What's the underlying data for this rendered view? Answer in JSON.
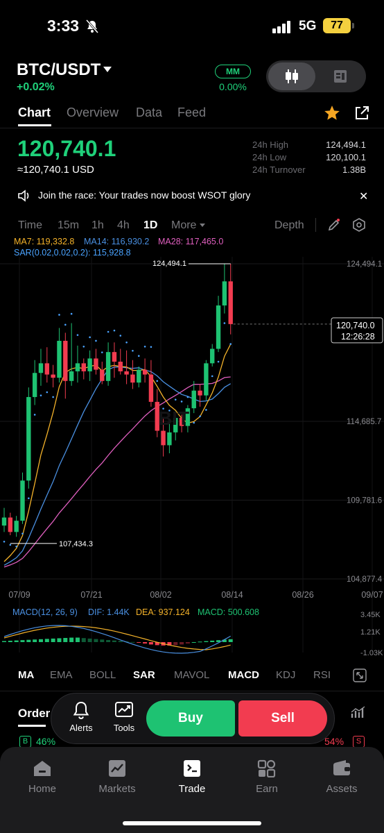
{
  "status": {
    "time": "3:33",
    "network": "5G",
    "battery": "77"
  },
  "header": {
    "pair": "BTC/USDT",
    "change": "+0.02%",
    "mm_label": "MM",
    "mm_value": "0.00%"
  },
  "tabs": [
    "Chart",
    "Overview",
    "Data",
    "Feed"
  ],
  "price": {
    "last": "120,740.1",
    "usd": "≈120,740.1 USD",
    "stats": [
      {
        "label": "24h High",
        "value": "124,494.1"
      },
      {
        "label": "24h Low",
        "value": "120,100.1"
      },
      {
        "label": "24h Turnover",
        "value": "1.38B"
      }
    ]
  },
  "announcement": "Join the race: Your trades now boost WSOT glory",
  "timeframes": [
    "Time",
    "15m",
    "1h",
    "4h",
    "1D",
    "More"
  ],
  "depth_label": "Depth",
  "ma_legend": {
    "ma7": "MA7: 119,332.8",
    "ma14": "MA14: 116,930.2",
    "ma28": "MA28: 117,465.0",
    "sar": "SAR(0.02,0.02,0.2): 115,928.8"
  },
  "colors": {
    "up": "#1ec272",
    "down": "#f23c50",
    "ma7": "#f5b32a",
    "ma14": "#4a90e2",
    "ma28": "#e05fbf",
    "sar": "#4aa3ff"
  },
  "chart_data": {
    "type": "candlestick",
    "y_ticks": [
      "124,494.1",
      "114,685.7",
      "109,781.6",
      "104,877.4"
    ],
    "x_ticks": [
      "07/09",
      "07/21",
      "08/02",
      "08/14",
      "08/26",
      "09/07"
    ],
    "ylim": [
      104877.4,
      124494.1
    ],
    "high_label": "124,494.1",
    "low_label": "107,434.3",
    "last_price_label": "120,740.0",
    "countdown": "12:26:28",
    "candles": [
      [
        108200,
        109300,
        107800,
        108700
      ],
      [
        108700,
        109000,
        107600,
        107800
      ],
      [
        107800,
        108800,
        107500,
        108500
      ],
      [
        108500,
        111500,
        108300,
        111000
      ],
      [
        111000,
        116800,
        110500,
        116200
      ],
      [
        116200,
        118500,
        115700,
        117700
      ],
      [
        117700,
        119200,
        116900,
        118300
      ],
      [
        118300,
        119300,
        117100,
        117600
      ],
      [
        117600,
        118200,
        116800,
        117400
      ],
      [
        117400,
        120500,
        117100,
        119700
      ],
      [
        119700,
        120200,
        116100,
        117200
      ],
      [
        117200,
        120800,
        116900,
        117800
      ],
      [
        117800,
        119400,
        117100,
        118300
      ],
      [
        118300,
        118600,
        117300,
        117800
      ],
      [
        117800,
        119100,
        117200,
        118600
      ],
      [
        118600,
        119200,
        117600,
        117900
      ],
      [
        117900,
        118400,
        117000,
        117200
      ],
      [
        117200,
        119600,
        116900,
        119000
      ],
      [
        119000,
        119600,
        117400,
        118400
      ],
      [
        118400,
        119200,
        117600,
        117800
      ],
      [
        117800,
        119100,
        117000,
        117600
      ],
      [
        117600,
        118500,
        116700,
        117100
      ],
      [
        117100,
        118100,
        116800,
        117900
      ],
      [
        117900,
        118600,
        117100,
        117600
      ],
      [
        117600,
        118500,
        115600,
        115900
      ],
      [
        115900,
        116700,
        113700,
        114100
      ],
      [
        114100,
        114900,
        112500,
        113200
      ],
      [
        113200,
        114700,
        112700,
        114000
      ],
      [
        114000,
        115300,
        113500,
        114900
      ],
      [
        114900,
        115100,
        114000,
        114400
      ],
      [
        114400,
        115700,
        114000,
        115500
      ],
      [
        115500,
        117200,
        115200,
        116600
      ],
      [
        116600,
        117000,
        115600,
        116300
      ],
      [
        116300,
        118500,
        116000,
        118300
      ],
      [
        118300,
        119500,
        118100,
        119200
      ],
      [
        119200,
        122500,
        119000,
        121900
      ],
      [
        121900,
        124500,
        121400,
        123400
      ],
      [
        123400,
        124494,
        120100,
        120740
      ]
    ]
  },
  "macd": {
    "label": "MACD(12, 26, 9)",
    "dif": "DIF: 1.44K",
    "dea": "DEA: 937.124",
    "macd": "MACD: 500.608",
    "y_ticks": [
      "3.45K",
      "1.21K",
      "-1.03K"
    ]
  },
  "indicators": [
    "MA",
    "EMA",
    "BOLL",
    "SAR",
    "MAVOL",
    "MACD",
    "KDJ",
    "RSI"
  ],
  "orders": {
    "tab": "Order",
    "buy_badge": "B",
    "buy_pct": "46%",
    "sell_pct": "54%",
    "sell_badge": "S"
  },
  "trade_bar": {
    "alerts": "Alerts",
    "tools": "Tools",
    "buy": "Buy",
    "sell": "Sell"
  },
  "nav": [
    "Home",
    "Markets",
    "Trade",
    "Earn",
    "Assets"
  ]
}
